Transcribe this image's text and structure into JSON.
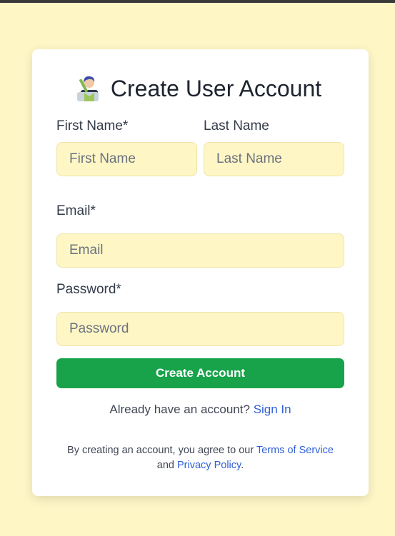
{
  "form": {
    "title": "Create User Account",
    "first_name": {
      "label": "First Name*",
      "placeholder": "First Name"
    },
    "last_name": {
      "label": "Last Name",
      "placeholder": "Last Name"
    },
    "email": {
      "label": "Email*",
      "placeholder": "Email"
    },
    "password": {
      "label": "Password*",
      "placeholder": "Password"
    },
    "submit_label": "Create Account",
    "signin_prompt": "Already have an account?",
    "signin_link": "Sign In",
    "terms_prefix": "By creating an account, you agree to our",
    "terms_link": "Terms of Service",
    "terms_and": "and",
    "privacy_link": "Privacy Policy",
    "terms_suffix": "."
  },
  "colors": {
    "page_background": "#fef6c5",
    "input_background": "#fef6c5",
    "button": "#18a34a",
    "link": "#2f5fd6"
  },
  "icons": {
    "avatar": "user-avatar-icon"
  }
}
